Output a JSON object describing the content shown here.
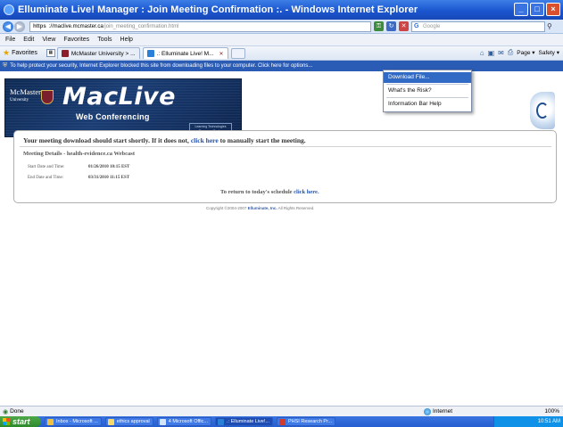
{
  "window": {
    "title": "Elluminate Live! Manager : Join Meeting Confirmation :. - Windows Internet Explorer",
    "minimize": "_",
    "maximize": "□",
    "close": "×"
  },
  "address": {
    "protocol": "https",
    "host": "://maclive.mcmaster.ca",
    "path": "/join_meeting_confirmation.html",
    "search_placeholder": "Google"
  },
  "menu": [
    "File",
    "Edit",
    "View",
    "Favorites",
    "Tools",
    "Help"
  ],
  "favorites": {
    "label": "Favorites",
    "tabs": [
      {
        "label": "McMaster University > ...",
        "icon_color": "#8a1f2b"
      },
      {
        "label": ".: Elluminate Live! M...",
        "icon_color": "#2a7fd9",
        "active": true
      }
    ],
    "commands": [
      "Page ▾",
      "Safety ▾"
    ]
  },
  "infobar": {
    "text": "To help protect your security, Internet Explorer blocked this site from downloading files to your computer. Click here for options..."
  },
  "context_menu": {
    "items": [
      "Download File...",
      "What's the Risk?",
      "Information Bar Help"
    ],
    "highlighted": 0
  },
  "banner": {
    "university": "McMaster",
    "university_sub": "University",
    "product": "MacLive",
    "tagline": "Web Conferencing",
    "badge": "Learning Technologies Resource Centre"
  },
  "content": {
    "message_pre": "Your meeting download should start shortly. If it does not, ",
    "message_link": "click here",
    "message_post": " to manually start the meeting.",
    "details_heading": "Meeting Details - health-evidence.ca Webcast",
    "start_label": "Start Date and Time:",
    "start_value": "01/26/2010 10:15 EST",
    "end_label": "End Date and Time:",
    "end_value": "03/31/2010 11:15 EST",
    "return_pre": "To return to today's schedule ",
    "return_link": "click here.",
    "copyright_pre": "Copyright ©2004-2007 ",
    "copyright_company": "Elluminate, Inc.",
    "copyright_post": " All Rights Reserved."
  },
  "status": {
    "text": "Done",
    "zone": "Internet",
    "zoom": "100%"
  },
  "taskbar": {
    "start": "start",
    "tasks": [
      {
        "label": "Inbox - Microsoft ...",
        "color": "#f0c040"
      },
      {
        "label": "ethics approval",
        "color": "#f7d86a"
      },
      {
        "label": "4 Microsoft Offic...",
        "color": "#d6e4fa"
      },
      {
        "label": ".: Elluminate Live!...",
        "color": "#2a7fd9",
        "active": true
      },
      {
        "label": "PHSI Research Pr...",
        "color": "#d13b2f"
      }
    ],
    "clock": "10:51 AM"
  }
}
